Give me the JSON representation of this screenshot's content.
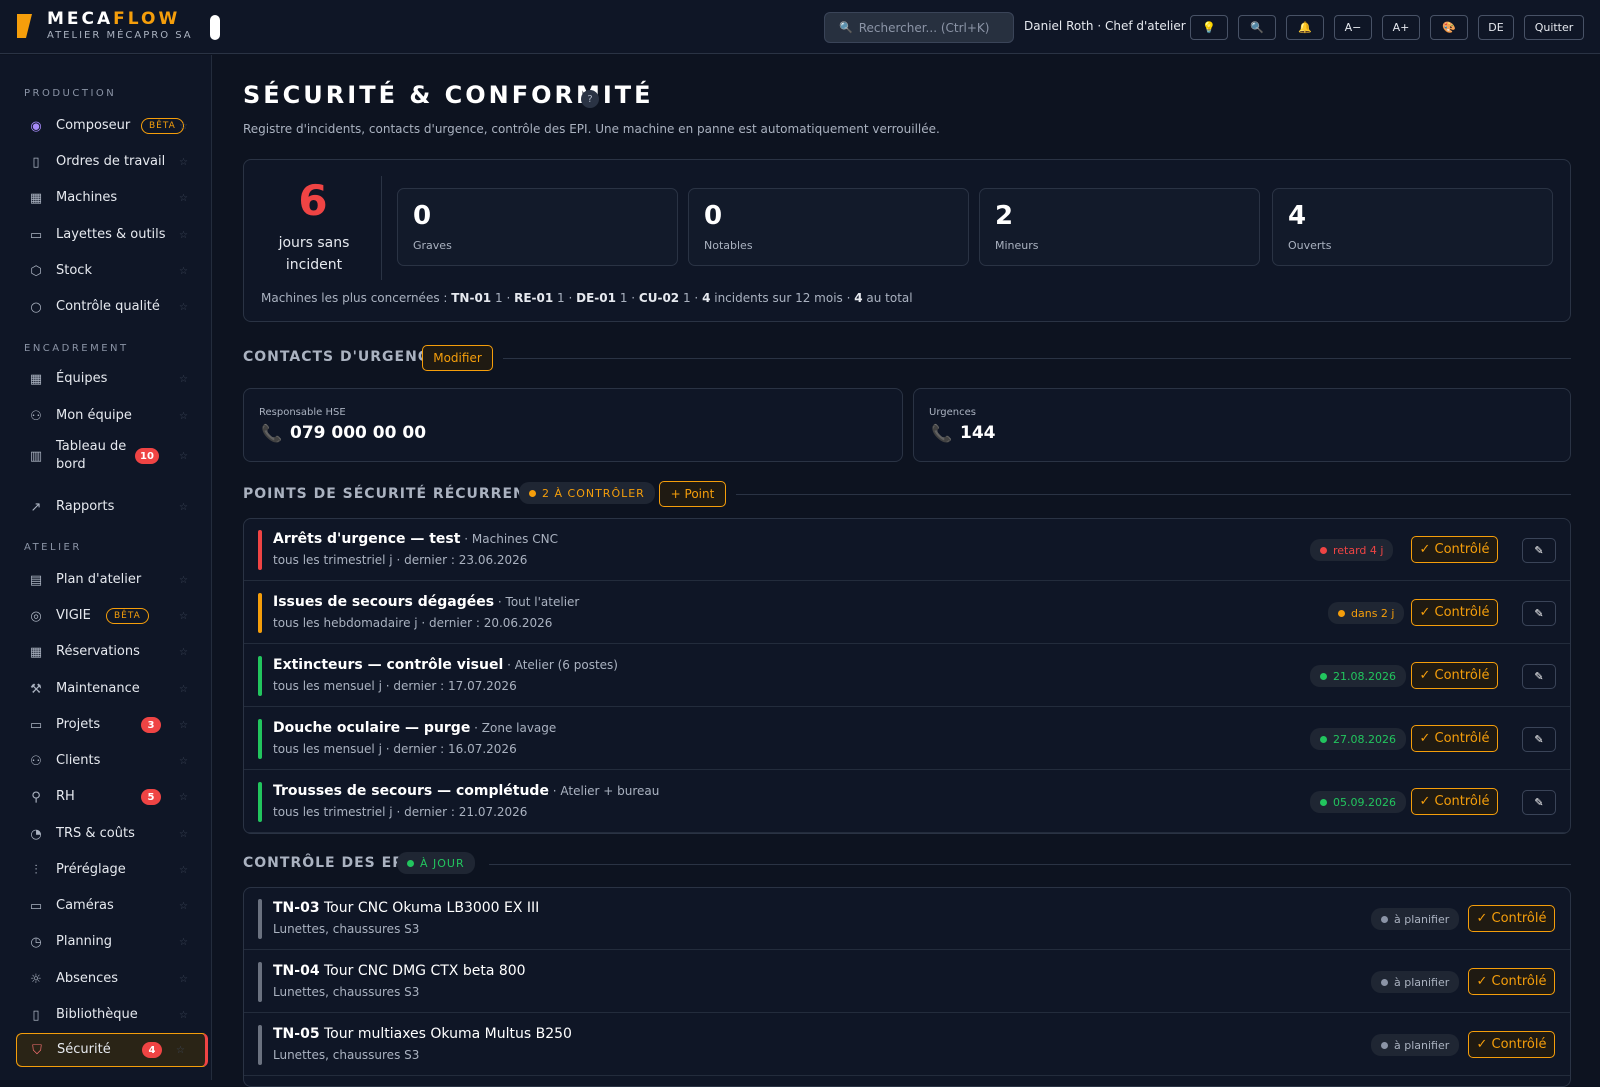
{
  "header": {
    "brand_a": "MECA",
    "brand_b": "FLOW",
    "brand_sub": "ATELIER MÉCAPRO SA",
    "search_placeholder": "Rechercher...  (Ctrl+K)",
    "user": "Daniel Roth · Chef d'atelier",
    "buttons": {
      "idea": "💡",
      "search": "🔍",
      "bell": "🔔",
      "font_minus": "A−",
      "font_plus": "A+",
      "theme": "🎨",
      "lang": "DE",
      "quit": "Quitter"
    }
  },
  "sidebar": {
    "sections": {
      "production": "PRODUCTION",
      "encadrement": "ENCADREMENT",
      "atelier": "ATELIER"
    },
    "items": [
      {
        "label": "Composeur",
        "icon": "composer-icon",
        "badge": "BÊTA"
      },
      {
        "label": "Ordres de travail",
        "icon": "clipboard-icon"
      },
      {
        "label": "Machines",
        "icon": "grid-icon"
      },
      {
        "label": "Layettes & outils",
        "icon": "archive-icon"
      },
      {
        "label": "Stock",
        "icon": "box-icon"
      },
      {
        "label": "Contrôle qualité",
        "icon": "search-icon"
      },
      {
        "label": "Équipes",
        "icon": "grid-icon"
      },
      {
        "label": "Mon équipe",
        "icon": "users-icon"
      },
      {
        "label": "Tableau de bord",
        "icon": "bar-chart-icon",
        "badge": "10"
      },
      {
        "label": "Rapports",
        "icon": "trend-icon"
      },
      {
        "label": "Plan d'atelier",
        "icon": "map-icon"
      },
      {
        "label": "VIGIE",
        "icon": "target-icon",
        "badge": "BÊTA"
      },
      {
        "label": "Réservations",
        "icon": "calendar-icon"
      },
      {
        "label": "Maintenance",
        "icon": "wrench-icon"
      },
      {
        "label": "Projets",
        "icon": "folder-icon",
        "badge": "3"
      },
      {
        "label": "Clients",
        "icon": "users-icon"
      },
      {
        "label": "RH",
        "icon": "user-icon",
        "badge": "5"
      },
      {
        "label": "TRS & coûts",
        "icon": "gauge-icon"
      },
      {
        "label": "Préréglage",
        "icon": "sliders-icon"
      },
      {
        "label": "Caméras",
        "icon": "monitor-icon"
      },
      {
        "label": "Planning",
        "icon": "clock-icon"
      },
      {
        "label": "Absences",
        "icon": "sun-icon"
      },
      {
        "label": "Bibliothèque",
        "icon": "book-icon"
      },
      {
        "label": "Sécurité",
        "icon": "shield-icon",
        "badge": "4"
      }
    ]
  },
  "page": {
    "title": "SÉCURITÉ & CONFORMITÉ",
    "help": "?",
    "subtitle": "Registre d'incidents, contacts d'urgence, contrôle des EPI. Une machine en panne est automatiquement verrouillée.",
    "days_without_incident": "6",
    "days_label": "jours sans incident",
    "stats": [
      {
        "value": "0",
        "label": "Graves"
      },
      {
        "value": "0",
        "label": "Notables"
      },
      {
        "value": "2",
        "label": "Mineurs"
      },
      {
        "value": "4",
        "label": "Ouverts"
      }
    ],
    "concern": {
      "prefix": "Machines les plus concernées : ",
      "machines": [
        {
          "code": "TN-01",
          "count": "1"
        },
        {
          "code": "RE-01",
          "count": "1"
        },
        {
          "code": "DE-01",
          "count": "1"
        },
        {
          "code": "CU-02",
          "count": "1"
        }
      ],
      "incidents_n": "4",
      "incidents_txt": " incidents sur 12 mois · ",
      "total_n": "4",
      "total_txt": " au total"
    }
  },
  "contacts": {
    "heading": "CONTACTS D'URGENCE",
    "edit": "Modifier",
    "items": [
      {
        "label": "Responsable HSE",
        "value": "079 000 00 00"
      },
      {
        "label": "Urgences",
        "value": "144"
      }
    ]
  },
  "recurring": {
    "heading": "POINTS DE SÉCURITÉ RÉCURRENTS",
    "chip": "2 À CONTRÔLER",
    "add": "+ Point",
    "control_label": "✓ Contrôlé",
    "edit_icon": "✎",
    "rows": [
      {
        "title": "Arrêts d'urgence — test",
        "loc": " · Machines CNC",
        "sub": "tous les trimestriel j · dernier : 23.06.2026",
        "status": "retard 4 j",
        "color": "#ef4444"
      },
      {
        "title": "Issues de secours dégagées",
        "loc": " · Tout l'atelier",
        "sub": "tous les hebdomadaire j · dernier : 20.06.2026",
        "status": "dans 2 j",
        "color": "#f59e0b"
      },
      {
        "title": "Extincteurs — contrôle visuel",
        "loc": " · Atelier (6 postes)",
        "sub": "tous les mensuel j · dernier : 17.07.2026",
        "status": "21.08.2026",
        "color": "#22c55e"
      },
      {
        "title": "Douche oculaire — purge",
        "loc": " · Zone lavage",
        "sub": "tous les mensuel j · dernier : 16.07.2026",
        "status": "27.08.2026",
        "color": "#22c55e"
      },
      {
        "title": "Trousses de secours — complétude",
        "loc": " · Atelier + bureau",
        "sub": "tous les trimestriel j · dernier : 21.07.2026",
        "status": "05.09.2026",
        "color": "#22c55e"
      }
    ]
  },
  "epi": {
    "heading": "CONTRÔLE DES EPI",
    "chip": "À JOUR",
    "control_label": "✓ Contrôlé",
    "rows": [
      {
        "code": "TN-03",
        "name": " Tour CNC Okuma LB3000 EX III",
        "sub": "Lunettes, chaussures S3",
        "status": "à planifier"
      },
      {
        "code": "TN-04",
        "name": " Tour CNC DMG CTX beta 800",
        "sub": "Lunettes, chaussures S3",
        "status": "à planifier"
      },
      {
        "code": "TN-05",
        "name": " Tour multiaxes Okuma Multus B250",
        "sub": "Lunettes, chaussures S3",
        "status": "à planifier"
      }
    ]
  },
  "colors": {
    "accent": "#f59e0b",
    "danger": "#ef4444",
    "ok": "#22c55e",
    "muted": "#8b94a6"
  }
}
